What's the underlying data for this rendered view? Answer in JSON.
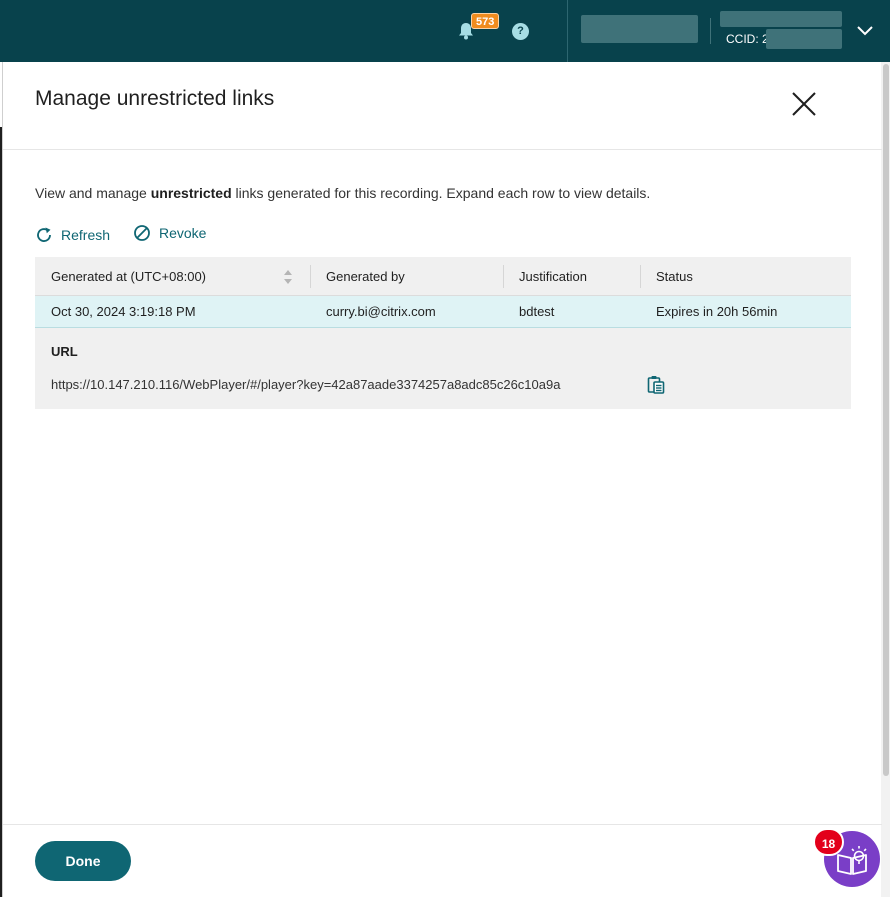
{
  "topbar": {
    "notification_count": "573",
    "help_glyph": "?",
    "account_ccid": "CCID: 2",
    "icons": [
      "bell-icon",
      "help-icon",
      "chevron-down-icon"
    ]
  },
  "modal": {
    "title": "Manage unrestricted links",
    "description_pre": "View and manage ",
    "description_bold": "unrestricted",
    "description_post": " links generated for this recording. Expand each row to view details.",
    "actions": {
      "refresh_label": "Refresh",
      "revoke_label": "Revoke"
    },
    "table": {
      "columns": [
        "Generated at (UTC+08:00)",
        "Generated by",
        "Justification",
        "Status"
      ],
      "rows": [
        {
          "generated_at": "Oct 30, 2024 3:19:18 PM",
          "generated_by": "curry.bi@citrix.com",
          "justification": "bdtest",
          "status": "Expires in 20h 56min"
        }
      ],
      "details": {
        "url_label": "URL",
        "url_value": "https://10.147.210.116/WebPlayer/#/player?key=42a87aade3374257a8adc85c26c10a9a"
      }
    },
    "done_label": "Done"
  },
  "help_fab": {
    "badge_count": "18"
  },
  "colors": {
    "topbar": "#08424c",
    "accent": "#0f6673",
    "selected_row": "#dff3f5",
    "notification_badge": "#f08c1e",
    "fab": "#7a3ec7",
    "fab_badge": "#e3001b"
  }
}
